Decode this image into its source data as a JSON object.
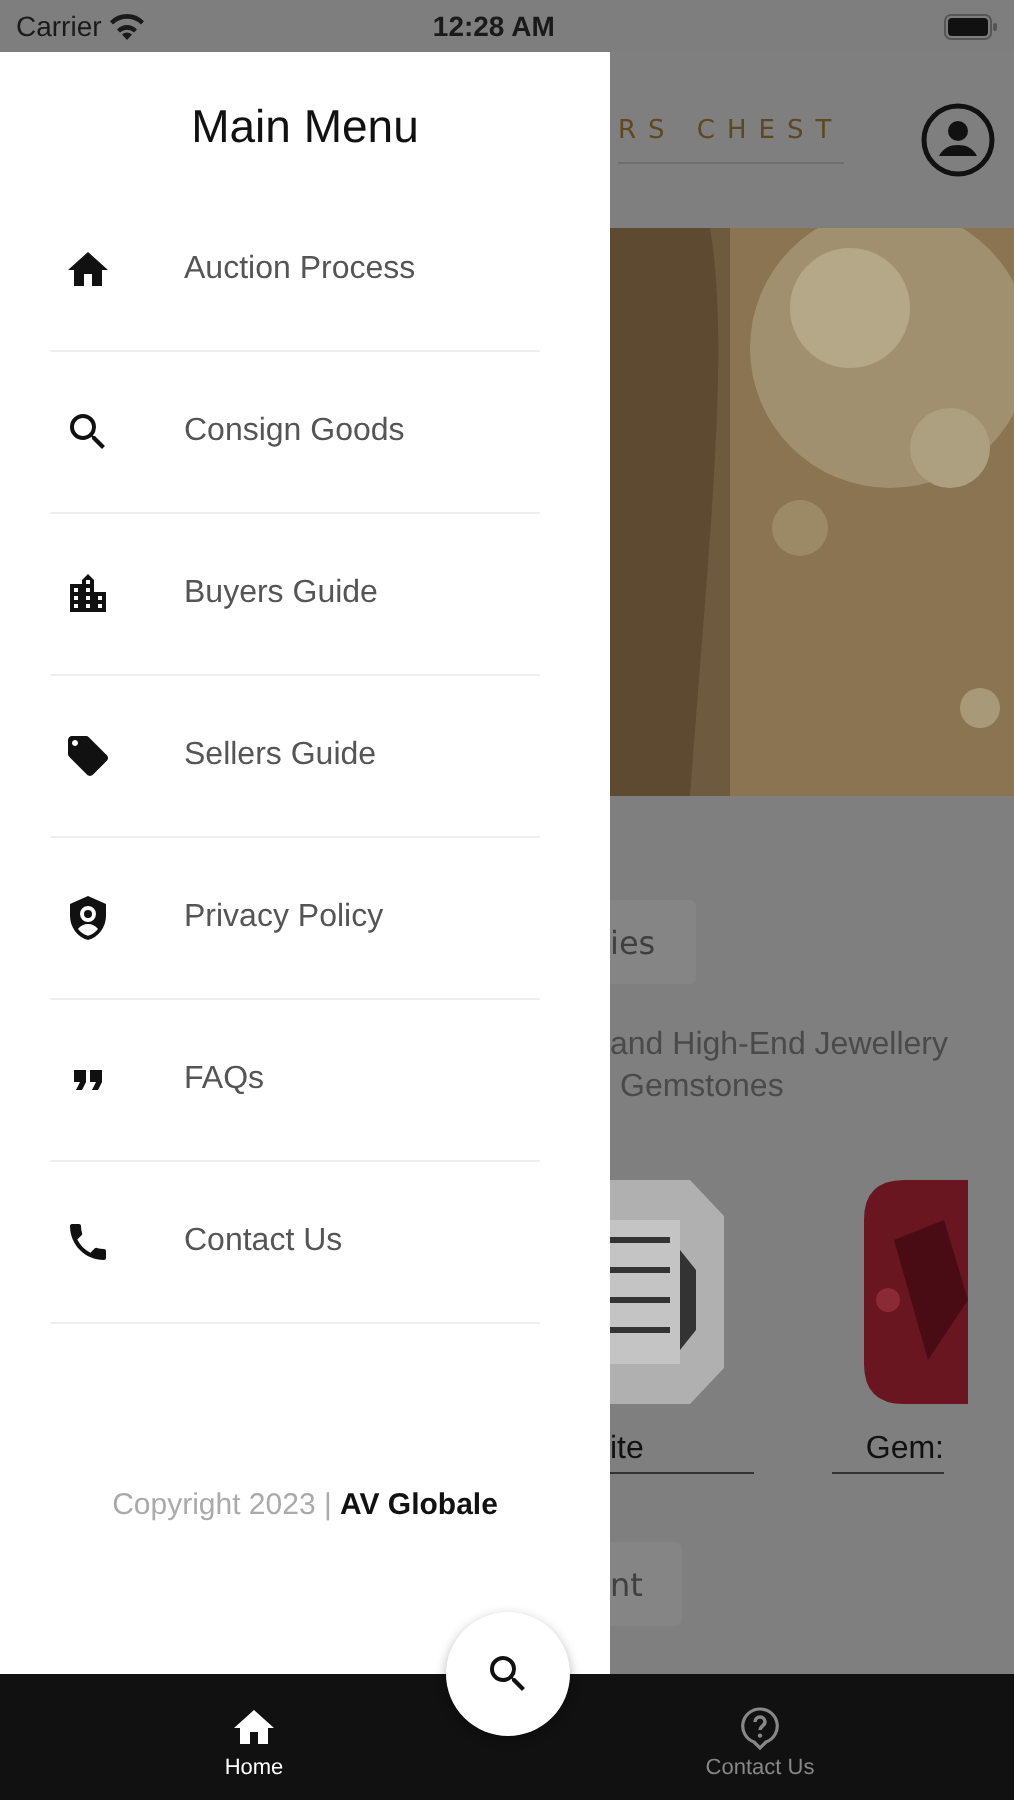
{
  "status_bar": {
    "carrier": "Carrier",
    "time": "12:28 AM"
  },
  "drawer": {
    "title": "Main Menu",
    "items": [
      {
        "label": "Auction Process"
      },
      {
        "label": "Consign Goods"
      },
      {
        "label": "Buyers Guide"
      },
      {
        "label": "Sellers Guide"
      },
      {
        "label": "Privacy Policy"
      },
      {
        "label": "FAQs"
      },
      {
        "label": "Contact Us"
      }
    ],
    "copyright": "Copyright 2023 | **AV Globale**"
  },
  "background_page": {
    "logo": "RS CHEST",
    "chip_1": "ies",
    "intro_lines": [
      "and High-End Jewellery",
      "Gemstones"
    ],
    "categories": [
      {
        "label": "ite"
      },
      {
        "label": "Gem:"
      }
    ],
    "chip_2": "nt"
  },
  "tab_bar": {
    "tabs": [
      {
        "label": "Home",
        "selected": true
      },
      {
        "label": "Contact Us",
        "selected": false
      }
    ]
  }
}
